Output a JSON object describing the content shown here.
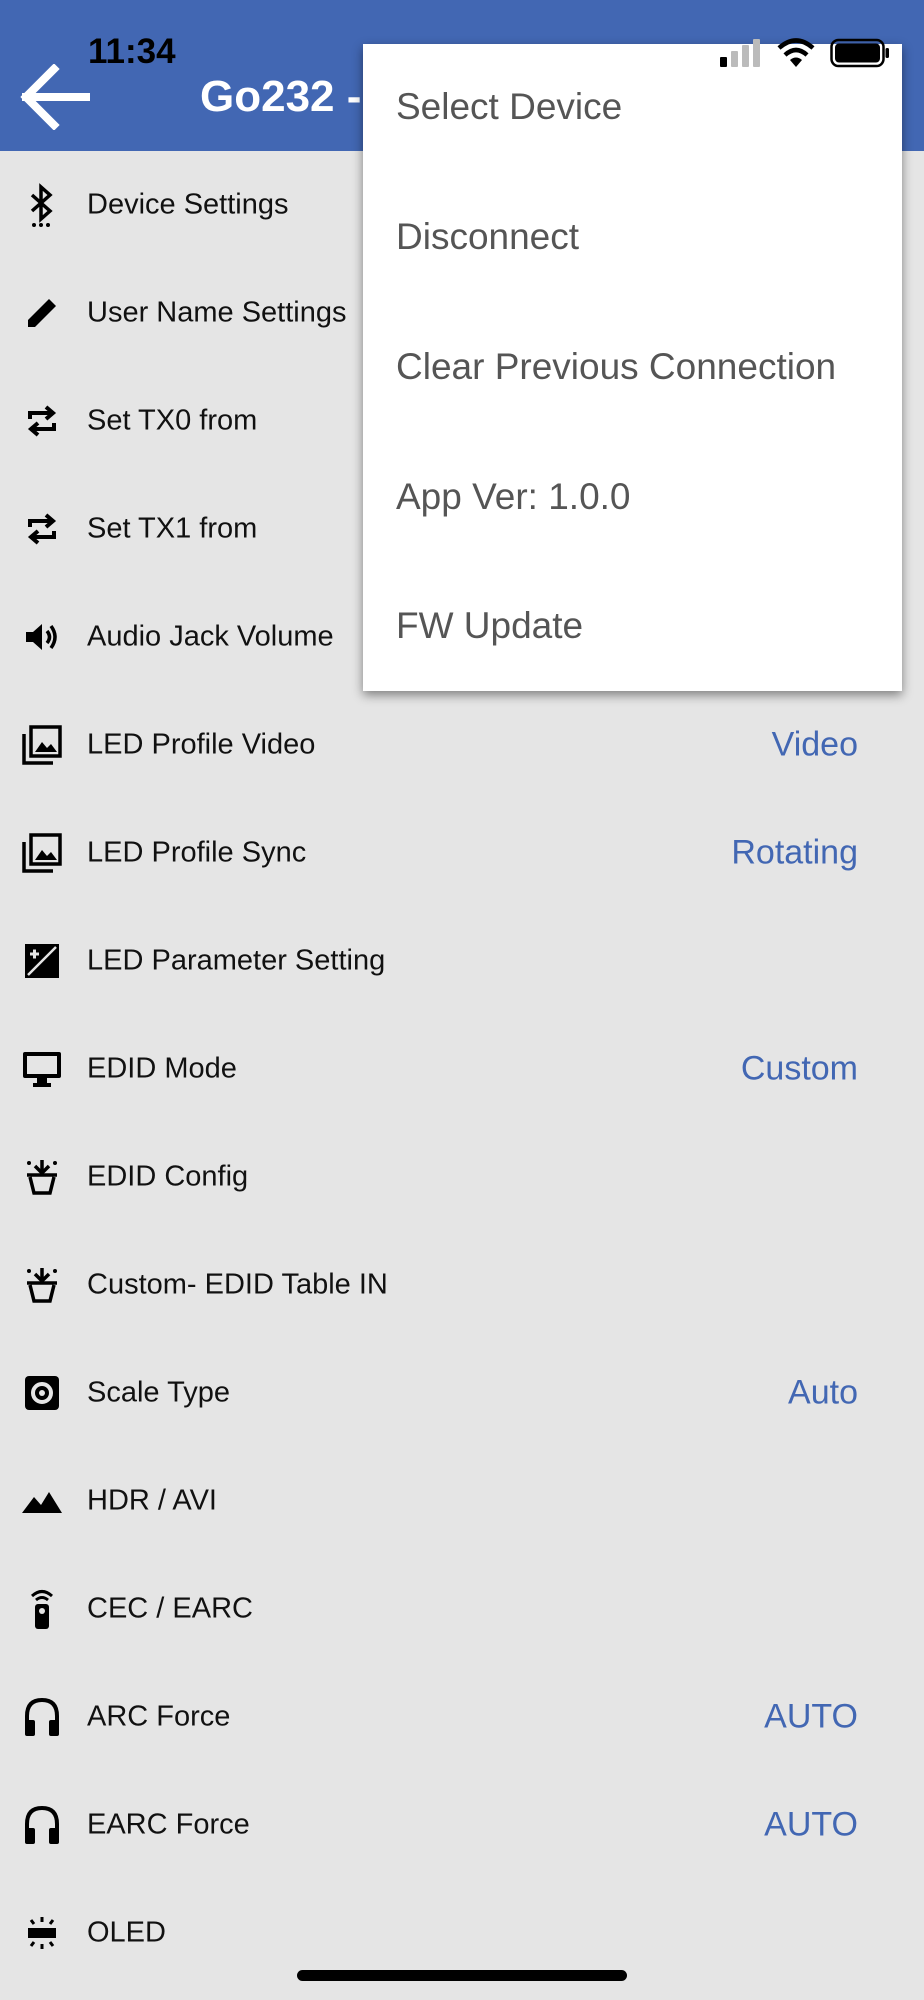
{
  "status_bar": {
    "time": "11:34"
  },
  "header": {
    "title": "Go232 -"
  },
  "menu": {
    "items": [
      {
        "label": "Select Device"
      },
      {
        "label": "Disconnect"
      },
      {
        "label": "Clear Previous Connection"
      },
      {
        "label": "App Ver: 1.0.0"
      },
      {
        "label": "FW Update"
      }
    ]
  },
  "settings": {
    "rows": [
      {
        "icon": "bluetooth-icon",
        "label": "Device Settings",
        "value": ""
      },
      {
        "icon": "pencil-icon",
        "label": "User Name Settings",
        "value": ""
      },
      {
        "icon": "repeat-icon",
        "label": "Set TX0 from",
        "value": ""
      },
      {
        "icon": "repeat-icon",
        "label": "Set TX1 from",
        "value": ""
      },
      {
        "icon": "volume-icon",
        "label": "Audio Jack Volume",
        "value": ""
      },
      {
        "icon": "image-stack-icon",
        "label": "LED Profile Video",
        "value": "Video"
      },
      {
        "icon": "image-stack-icon",
        "label": "LED Profile Sync",
        "value": "Rotating"
      },
      {
        "icon": "exposure-icon",
        "label": "LED Parameter Setting",
        "value": ""
      },
      {
        "icon": "monitor-icon",
        "label": "EDID Mode",
        "value": "Custom"
      },
      {
        "icon": "download-tray-icon",
        "label": "EDID Config",
        "value": ""
      },
      {
        "icon": "download-tray-icon",
        "label": "Custom- EDID Table IN",
        "value": ""
      },
      {
        "icon": "gear-box-icon",
        "label": "Scale Type",
        "value": "Auto"
      },
      {
        "icon": "mountain-icon",
        "label": "HDR / AVI",
        "value": ""
      },
      {
        "icon": "remote-icon",
        "label": "CEC / EARC",
        "value": ""
      },
      {
        "icon": "headphones-icon",
        "label": "ARC Force",
        "value": "AUTO"
      },
      {
        "icon": "headphones-icon",
        "label": "EARC Force",
        "value": "AUTO"
      },
      {
        "icon": "oled-icon",
        "label": "OLED",
        "value": ""
      }
    ]
  },
  "colors": {
    "accent": "#4267b3",
    "background": "#e5e5e5",
    "menu_text": "#555555"
  }
}
